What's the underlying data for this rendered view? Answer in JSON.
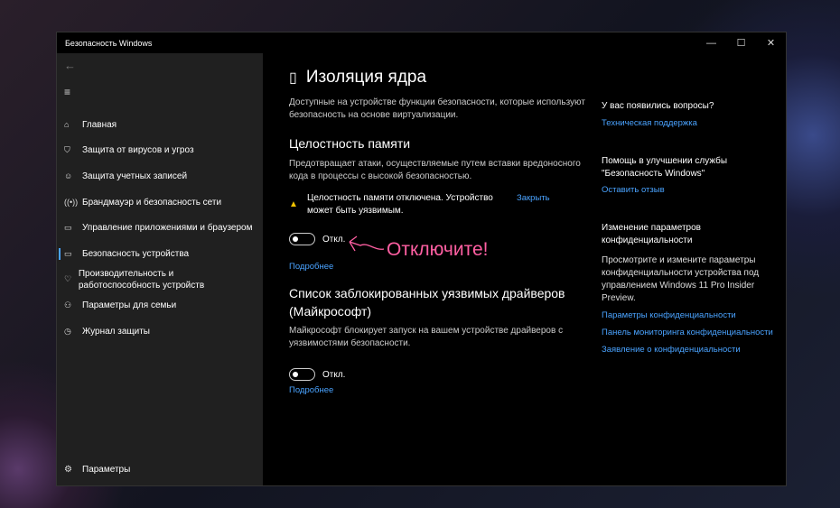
{
  "window": {
    "title": "Безопасность Windows",
    "minimize": "—",
    "maximize": "☐",
    "close": "✕"
  },
  "sidebar": {
    "items": [
      {
        "label": "Главная",
        "icon": "⌂"
      },
      {
        "label": "Защита от вирусов и угроз",
        "icon": "⛉"
      },
      {
        "label": "Защита учетных записей",
        "icon": "☺"
      },
      {
        "label": "Брандмауэр и безопасность сети",
        "icon": "((•))"
      },
      {
        "label": "Управление приложениями и браузером",
        "icon": "▭"
      },
      {
        "label": "Безопасность устройства",
        "icon": "▭",
        "selected": true
      },
      {
        "label": "Производительность и работоспособность устройств",
        "icon": "♡"
      },
      {
        "label": "Параметры для семьи",
        "icon": "⚇"
      },
      {
        "label": "Журнал защиты",
        "icon": "◷"
      }
    ],
    "settings": "Параметры",
    "back": "←",
    "menu": "≡"
  },
  "main": {
    "title": "Изоляция ядра",
    "description": "Доступные на устройстве функции безопасности, которые используют безопасность на основе виртуализации.",
    "memory": {
      "title": "Целостность памяти",
      "description": "Предотвращает атаки, осуществляемые путем вставки вредоносного кода в процессы с высокой безопасностью.",
      "warning": "Целостность памяти отключена. Устройство может быть уязвимым.",
      "dismiss": "Закрыть",
      "toggle": "Откл.",
      "more": "Подробнее"
    },
    "drivers": {
      "title": "Список заблокированных уязвимых драйверов (Майкрософт)",
      "description": "Майкрософт блокирует запуск на вашем устройстве драйверов с уязвимостями безопасности.",
      "toggle": "Откл.",
      "more": "Подробнее"
    },
    "annotation": "Отключите!"
  },
  "right": {
    "q_title": "У вас появились вопросы?",
    "support": "Техническая поддержка",
    "improve_title": "Помощь в улучшении службы \"Безопасность Windows\"",
    "feedback": "Оставить отзыв",
    "privacy_title": "Изменение параметров конфиденциальности",
    "privacy_text": "Просмотрите и измените параметры конфиденциальности устройства под управлением Windows 11 Pro Insider Preview.",
    "privacy_settings": "Параметры конфиденциальности",
    "privacy_dashboard": "Панель мониторинга конфиденциальности",
    "privacy_statement": "Заявление о конфиденциальности"
  }
}
